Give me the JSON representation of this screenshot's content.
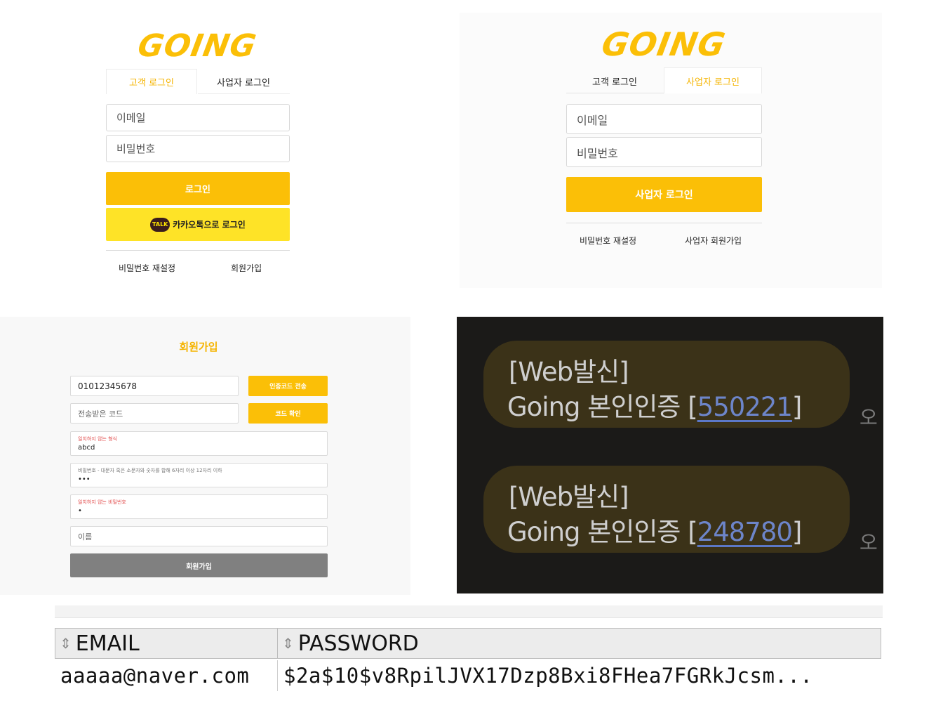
{
  "customer_login": {
    "logo": "GOING",
    "tabs": [
      "고객 로그인",
      "사업자 로그인"
    ],
    "email_placeholder": "이메일",
    "password_placeholder": "비밀번호",
    "login_button": "로그인",
    "kakao_badge": "TALK",
    "kakao_button": "카카오톡으로 로그인",
    "links": [
      "비밀번호 재설정",
      "회원가입"
    ]
  },
  "business_login": {
    "logo": "GOING",
    "tabs": [
      "고객 로그인",
      "사업자 로그인"
    ],
    "email_placeholder": "이메일",
    "password_placeholder": "비밀번호",
    "login_button": "사업자 로그인",
    "links": [
      "비밀번호 재설정",
      "사업자 회원가입"
    ]
  },
  "signup": {
    "title": "회원가입",
    "phone_value": "01012345678",
    "send_code_button": "인증코드 전송",
    "code_placeholder": "전송받은 코드",
    "verify_code_button": "코드 확인",
    "email_error": "일치하지 않는 형식",
    "email_value": "abcd",
    "password_hint": "비밀번호 - 대문자 혹은 소문자와 숫자를 합해 6자리 이상 12자리 이하",
    "password_value": "•••",
    "password_confirm_error": "일치하지 않는 비밀번호",
    "password_confirm_value": "•",
    "name_placeholder": "이름",
    "submit_button": "회원가입"
  },
  "sms": {
    "messages": [
      {
        "line1": "[Web발신]",
        "line2_prefix": "Going 본인인증 [",
        "code": "550221",
        "line2_suffix": "]"
      },
      {
        "line1": "[Web발신]",
        "line2_prefix": "Going 본인인증 [",
        "code": "248780",
        "line2_suffix": "]"
      }
    ],
    "side_text": "오"
  },
  "db": {
    "columns": [
      "EMAIL",
      "PASSWORD"
    ],
    "rows": [
      [
        "aaaaa@naver.com",
        "$2a$10$v8RpilJVX17Dzp8Bxi8FHea7FGRkJcsm..."
      ]
    ]
  },
  "colors": {
    "brand_yellow": "#fbbf07",
    "kakao_yellow": "#fee500",
    "disabled_gray": "#808080",
    "error_red": "#e24c4c"
  }
}
